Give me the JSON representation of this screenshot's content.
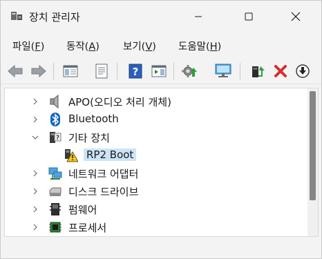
{
  "window": {
    "title": "장치 관리자"
  },
  "menu": [
    {
      "label": "파일(",
      "key": "F",
      "tail": ")"
    },
    {
      "label": "동작(",
      "key": "A",
      "tail": ")"
    },
    {
      "label": "보기(",
      "key": "V",
      "tail": ")"
    },
    {
      "label": "도움말(",
      "key": "H",
      "tail": ")"
    }
  ],
  "toolbar_icons": [
    "back-arrow-icon",
    "forward-arrow-icon",
    "show-hide-tree-icon",
    "properties-icon",
    "help-icon",
    "action-pane-icon",
    "scan-hardware-icon",
    "computer-monitor-icon",
    "update-driver-icon",
    "uninstall-device-icon",
    "disable-device-icon"
  ],
  "tree": [
    {
      "label": "APO(오디오 처리 개체)",
      "expanded": false,
      "icon": "speaker-icon"
    },
    {
      "label": "Bluetooth",
      "expanded": false,
      "icon": "bluetooth-icon"
    },
    {
      "label": "기타 장치",
      "expanded": true,
      "icon": "unknown-device-icon"
    },
    {
      "label": "RP2 Boot",
      "child": true,
      "selected": true,
      "icon": "warning-device-icon"
    },
    {
      "label": "네트워크 어댑터",
      "expanded": false,
      "icon": "network-adapter-icon"
    },
    {
      "label": "디스크 드라이브",
      "expanded": false,
      "icon": "disk-drive-icon"
    },
    {
      "label": "펌웨어",
      "expanded": false,
      "icon": "firmware-icon"
    },
    {
      "label": "프로세서",
      "expanded": false,
      "icon": "processor-icon"
    }
  ],
  "colors": {
    "selection": "#cce4f7",
    "accent_blue": "#1565c0",
    "red_x": "#d32f2f"
  }
}
